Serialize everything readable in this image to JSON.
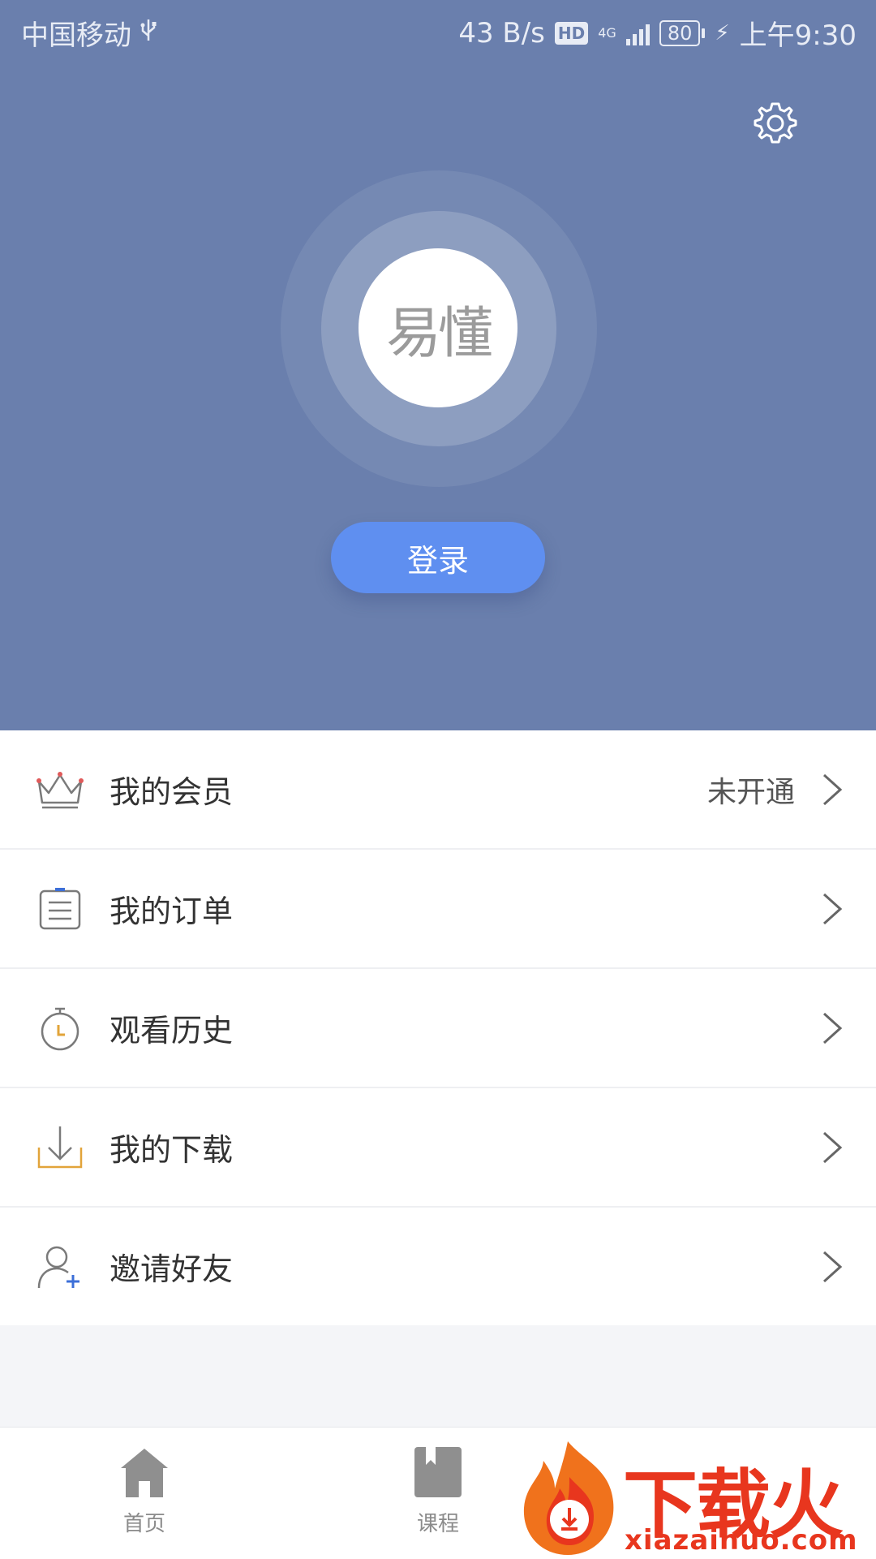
{
  "status_bar": {
    "carrier": "中国移动",
    "speed": "43 B/s",
    "hd": "HD",
    "network": "4G",
    "battery": "80",
    "time": "上午9:30"
  },
  "profile": {
    "avatar_text": "易懂",
    "login_label": "登录"
  },
  "menu": {
    "items": [
      {
        "label": "我的会员",
        "value": "未开通",
        "icon": "crown-icon"
      },
      {
        "label": "我的订单",
        "value": "",
        "icon": "clipboard-icon"
      },
      {
        "label": "观看历史",
        "value": "",
        "icon": "stopwatch-icon"
      },
      {
        "label": "我的下载",
        "value": "",
        "icon": "download-icon"
      },
      {
        "label": "邀请好友",
        "value": "",
        "icon": "add-user-icon"
      }
    ]
  },
  "bottom_nav": {
    "tabs": [
      {
        "label": "首页",
        "icon": "home-icon"
      },
      {
        "label": "课程",
        "icon": "book-icon"
      }
    ]
  },
  "watermark": {
    "title": "下载火",
    "url": "xiazaihuo.com"
  },
  "colors": {
    "header_bg": "#6a7fad",
    "login_button": "#5f8ff0",
    "watermark": "#e8361e"
  }
}
